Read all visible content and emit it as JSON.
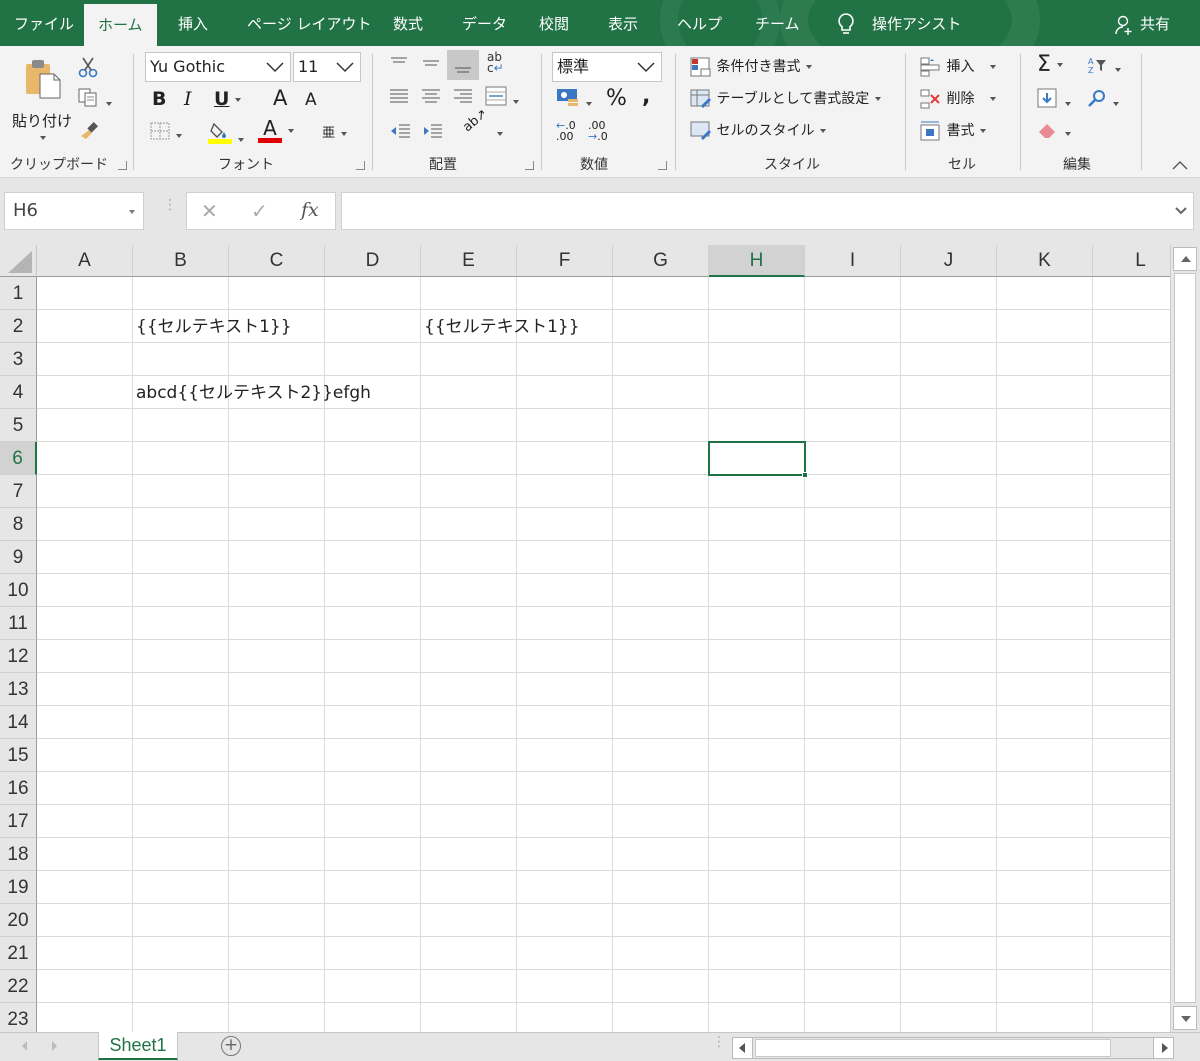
{
  "ribbon_tabs": [
    {
      "label": "ファイル",
      "active": false
    },
    {
      "label": "ホーム",
      "active": true
    },
    {
      "label": "挿入",
      "active": false
    },
    {
      "label": "ページ レイアウト",
      "active": false
    },
    {
      "label": "数式",
      "active": false
    },
    {
      "label": "データ",
      "active": false
    },
    {
      "label": "校閲",
      "active": false
    },
    {
      "label": "表示",
      "active": false
    },
    {
      "label": "ヘルプ",
      "active": false
    },
    {
      "label": "チーム",
      "active": false
    }
  ],
  "tell_me": {
    "label": "操作アシスト",
    "icon": "lightbulb-icon"
  },
  "share": {
    "label": "共有",
    "icon": "person-add-icon"
  },
  "accent_color": "#217346",
  "ribbon": {
    "clipboard": {
      "label": "クリップボード",
      "paste": "貼り付け",
      "icons": [
        "paste-icon",
        "cut-icon",
        "copy-icon",
        "format-painter-icon"
      ]
    },
    "font": {
      "label": "フォント",
      "font_name": "Yu Gothic",
      "font_size": "11",
      "bold": "B",
      "italic": "I",
      "underline": "U",
      "grow": "A",
      "shrink": "A",
      "font_color_letter": "A",
      "phonetic": "亜",
      "fill_color": "#ffff00",
      "text_color": "#e00000"
    },
    "alignment": {
      "label": "配置",
      "wrap": "ab c↵"
    },
    "number": {
      "label": "数値",
      "format": "標準",
      "percent": "%",
      "comma": ",",
      "inc_decimal": ".0 / .00",
      "dec_decimal": ".00 / .0"
    },
    "styles": {
      "label": "スタイル",
      "conditional": "条件付き書式",
      "as_table": "テーブルとして書式設定",
      "cell_styles": "セルのスタイル"
    },
    "cells": {
      "label": "セル",
      "insert": "挿入",
      "delete": "削除",
      "format": "書式"
    },
    "editing": {
      "label": "編集",
      "sum": "Σ"
    }
  },
  "formula_bar": {
    "name_box": "H6",
    "cancel": "✕",
    "enter": "✓",
    "fx": "fx",
    "value": ""
  },
  "columns": [
    "A",
    "B",
    "C",
    "D",
    "E",
    "F",
    "G",
    "H",
    "I",
    "J",
    "K",
    "L"
  ],
  "rows": [
    "1",
    "2",
    "3",
    "4",
    "5",
    "6",
    "7",
    "8",
    "9",
    "10",
    "11",
    "12",
    "13",
    "14",
    "15",
    "16",
    "17",
    "18",
    "19",
    "20",
    "21",
    "22",
    "23"
  ],
  "selected_cell": {
    "col": "H",
    "row": "6"
  },
  "cells": [
    {
      "ref": "B2",
      "col": 1,
      "row": 1,
      "value": "{{セルテキスト1}}"
    },
    {
      "ref": "E2",
      "col": 4,
      "row": 1,
      "value": "{{セルテキスト1}}"
    },
    {
      "ref": "B4",
      "col": 1,
      "row": 3,
      "value": "abcd{{セルテキスト2}}efgh"
    }
  ],
  "sheets": [
    {
      "name": "Sheet1",
      "active": true
    }
  ],
  "add_sheet": "⊕"
}
